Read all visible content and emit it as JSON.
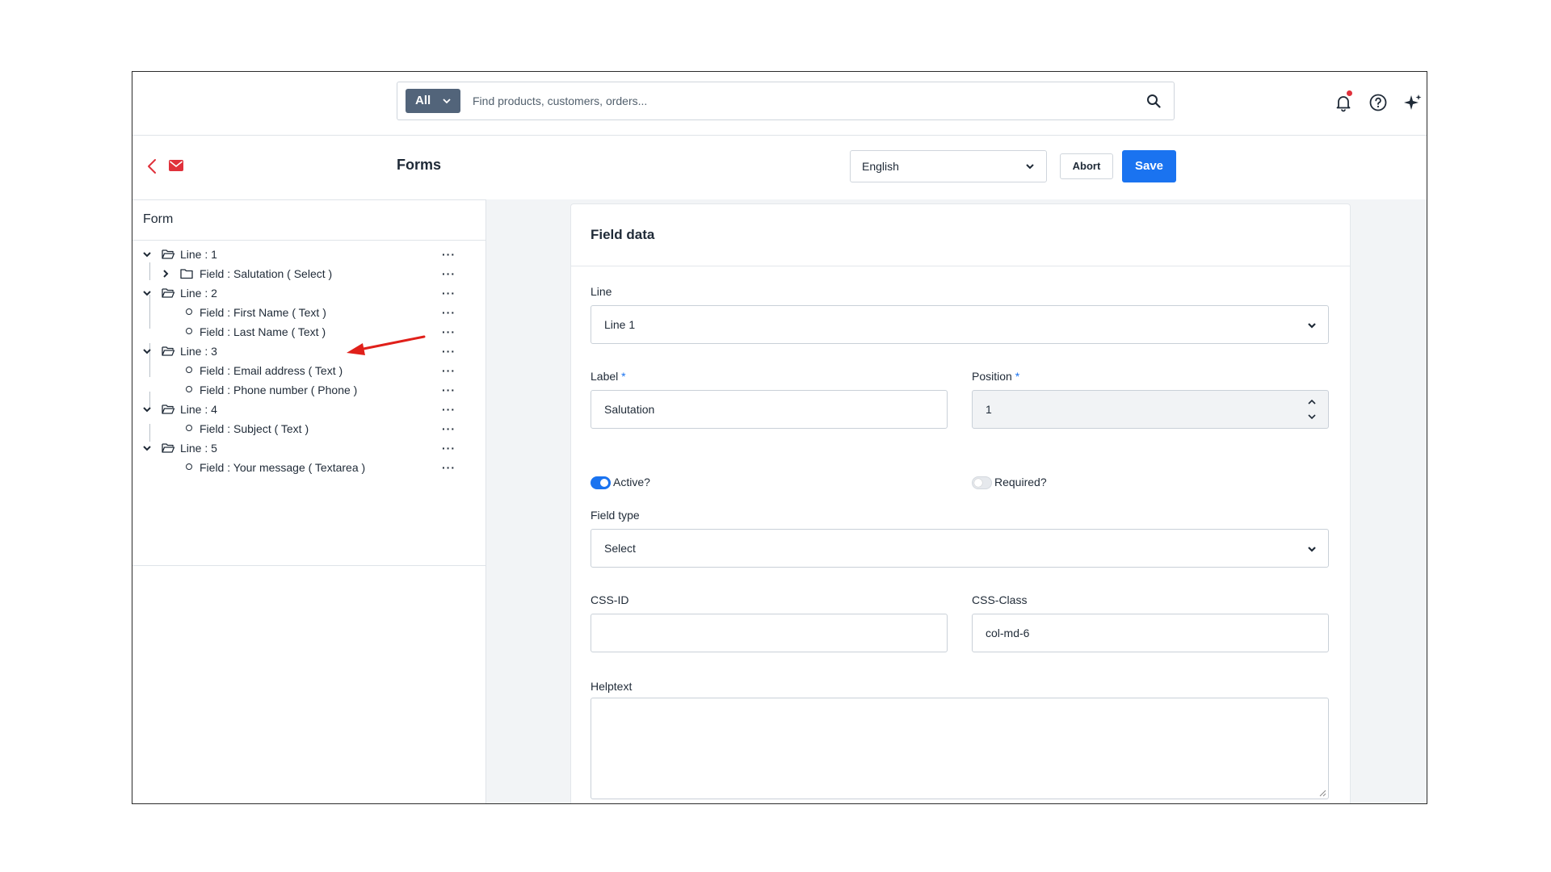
{
  "search": {
    "scope_label": "All",
    "placeholder": "Find products, customers, orders..."
  },
  "header_icons": [
    "bell-icon",
    "help-icon",
    "sparkle-icon"
  ],
  "page": {
    "title": "Forms",
    "language": "English",
    "abort_label": "Abort",
    "save_label": "Save"
  },
  "tree": {
    "header": "Form",
    "more": "···",
    "nodes": [
      {
        "label": "Line : 1",
        "type": "line",
        "expanded": true
      },
      {
        "label": "Field : Salutation ( Select )",
        "type": "folder-field",
        "expanded": false
      },
      {
        "label": "Line : 2",
        "type": "line",
        "expanded": true
      },
      {
        "label": "Field : First Name ( Text )",
        "type": "field"
      },
      {
        "label": "Field : Last Name ( Text )",
        "type": "field"
      },
      {
        "label": "Line : 3",
        "type": "line",
        "expanded": true
      },
      {
        "label": "Field : Email address ( Text )",
        "type": "field"
      },
      {
        "label": "Field : Phone number ( Phone )",
        "type": "field"
      },
      {
        "label": "Line : 4",
        "type": "line",
        "expanded": true
      },
      {
        "label": "Field : Subject ( Text )",
        "type": "field"
      },
      {
        "label": "Line : 5",
        "type": "line",
        "expanded": true
      },
      {
        "label": "Field : Your message ( Textarea )",
        "type": "field"
      }
    ]
  },
  "field_data": {
    "title": "Field data",
    "line_label": "Line",
    "line_value": "Line 1",
    "label_label": "Label",
    "label_value": "Salutation",
    "position_label": "Position",
    "position_value": "1",
    "required_mark": "*",
    "active_label": "Active?",
    "active_on": true,
    "required_label": "Required?",
    "required_on": false,
    "field_type_label": "Field type",
    "field_type_value": "Select",
    "css_id_label": "CSS-ID",
    "css_id_value": "",
    "css_class_label": "CSS-Class",
    "css_class_value": "col-md-6",
    "helptext_label": "Helptext",
    "helptext_value": ""
  },
  "colors": {
    "accent": "#1a73f0",
    "scope_bg": "#52647a",
    "brand_red": "#e0313b",
    "annotation_arrow": "#e0201a"
  }
}
